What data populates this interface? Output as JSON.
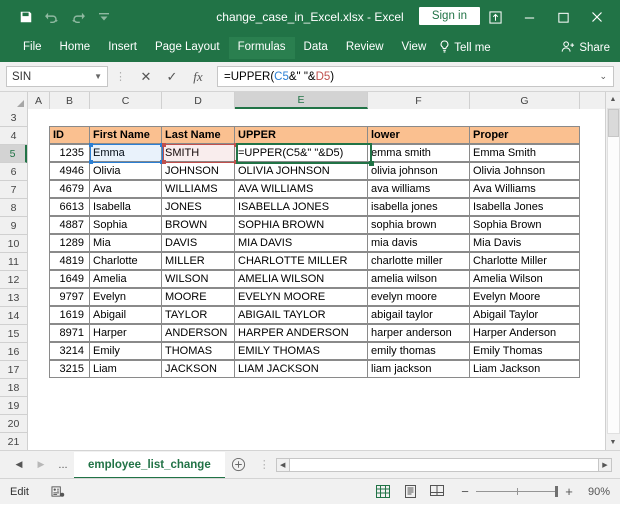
{
  "titlebar": {
    "filename": "change_case_in_Excel.xlsx  -  Excel",
    "signin_label": "Sign in",
    "qat": [
      {
        "name": "save-icon",
        "label": "Save"
      },
      {
        "name": "undo-icon",
        "label": "Undo"
      },
      {
        "name": "redo-icon",
        "label": "Redo"
      },
      {
        "name": "customize-quick-access-toolbar-icon",
        "label": "Customize Quick Access Toolbar"
      }
    ],
    "window_controls": [
      {
        "name": "ribbon-display-options-icon",
        "label": "Ribbon Display Options"
      },
      {
        "name": "minimize-icon",
        "label": "Minimize"
      },
      {
        "name": "maximize-icon",
        "label": "Maximize"
      },
      {
        "name": "close-icon",
        "label": "Close"
      }
    ]
  },
  "ribbon": {
    "tabs": [
      {
        "label": "File",
        "active": false
      },
      {
        "label": "Home",
        "active": false
      },
      {
        "label": "Insert",
        "active": false
      },
      {
        "label": "Page Layout",
        "active": false
      },
      {
        "label": "Formulas",
        "active": true
      },
      {
        "label": "Data",
        "active": false
      },
      {
        "label": "Review",
        "active": false
      },
      {
        "label": "View",
        "active": false
      }
    ],
    "tellme_label": "Tell me",
    "share_label": "Share"
  },
  "formula_bar": {
    "name_box_value": "SIN",
    "cancel_label": "✕",
    "enter_label": "✓",
    "insert_function_label": "fx",
    "formula_parts": [
      {
        "text": "=UPPER(",
        "color": "black"
      },
      {
        "text": "C5",
        "color": "blue"
      },
      {
        "text": "&\" \"&",
        "color": "black"
      },
      {
        "text": "D5",
        "color": "red"
      },
      {
        "text": ")",
        "color": "black"
      }
    ],
    "formula_full": "=UPPER(C5&\" \"&D5)"
  },
  "grid": {
    "columns": [
      "A",
      "B",
      "C",
      "D",
      "E",
      "F",
      "G"
    ],
    "selected_column": "E",
    "selected_row": "5",
    "rows": [
      "3",
      "4",
      "5",
      "6",
      "7",
      "8",
      "9",
      "10",
      "11",
      "12",
      "13",
      "14",
      "15",
      "16",
      "17",
      "18",
      "19",
      "20",
      "21"
    ],
    "header_row_index": "4",
    "headers": {
      "b": "ID",
      "c": "First Name",
      "d": "Last Name",
      "e": "UPPER",
      "f": "lower",
      "g": "Proper"
    },
    "data": [
      {
        "row": "5",
        "id": "1235",
        "first": "Emma",
        "last": "SMITH",
        "upper": "=UPPER(C5&\" \"&D5)",
        "lower": "emma smith",
        "proper": "Emma Smith"
      },
      {
        "row": "6",
        "id": "4946",
        "first": "Olivia",
        "last": "JOHNSON",
        "upper": "OLIVIA JOHNSON",
        "lower": "olivia johnson",
        "proper": "Olivia Johnson"
      },
      {
        "row": "7",
        "id": "4679",
        "first": "Ava",
        "last": "WILLIAMS",
        "upper": "AVA WILLIAMS",
        "lower": "ava williams",
        "proper": "Ava Williams"
      },
      {
        "row": "8",
        "id": "6613",
        "first": "Isabella",
        "last": "JONES",
        "upper": "ISABELLA JONES",
        "lower": "isabella jones",
        "proper": "Isabella Jones"
      },
      {
        "row": "9",
        "id": "4887",
        "first": "Sophia",
        "last": "BROWN",
        "upper": "SOPHIA BROWN",
        "lower": "sophia brown",
        "proper": "Sophia Brown"
      },
      {
        "row": "10",
        "id": "1289",
        "first": "Mia",
        "last": "DAVIS",
        "upper": "MIA DAVIS",
        "lower": "mia davis",
        "proper": "Mia Davis"
      },
      {
        "row": "11",
        "id": "4819",
        "first": "Charlotte",
        "last": "MILLER",
        "upper": "CHARLOTTE MILLER",
        "lower": "charlotte miller",
        "proper": "Charlotte Miller"
      },
      {
        "row": "12",
        "id": "1649",
        "first": "Amelia",
        "last": "WILSON",
        "upper": "AMELIA WILSON",
        "lower": "amelia wilson",
        "proper": "Amelia Wilson"
      },
      {
        "row": "13",
        "id": "9797",
        "first": "Evelyn",
        "last": "MOORE",
        "upper": "EVELYN MOORE",
        "lower": "evelyn moore",
        "proper": "Evelyn Moore"
      },
      {
        "row": "14",
        "id": "1619",
        "first": "Abigail",
        "last": "TAYLOR",
        "upper": "ABIGAIL TAYLOR",
        "lower": "abigail taylor",
        "proper": "Abigail Taylor"
      },
      {
        "row": "15",
        "id": "8971",
        "first": "Harper",
        "last": "ANDERSON",
        "upper": "HARPER ANDERSON",
        "lower": "harper anderson",
        "proper": "Harper Anderson"
      },
      {
        "row": "16",
        "id": "3214",
        "first": "Emily",
        "last": "THOMAS",
        "upper": "EMILY THOMAS",
        "lower": "emily thomas",
        "proper": "Emily Thomas"
      },
      {
        "row": "17",
        "id": "3215",
        "first": "Liam",
        "last": "JACKSON",
        "upper": "LIAM JACKSON",
        "lower": "liam jackson",
        "proper": "Liam Jackson"
      }
    ]
  },
  "sheet_bar": {
    "prev_label": "◀",
    "next_label": "▶",
    "ellipsis_label": "...",
    "active_sheet": "employee_list_change",
    "add_sheet_label": "+"
  },
  "status_bar": {
    "mode": "Edit",
    "accessibility_icon": "accessibility-checker-icon",
    "views": [
      {
        "name": "normal-view-icon",
        "active": true
      },
      {
        "name": "page-layout-view-icon",
        "active": false
      },
      {
        "name": "page-break-preview-icon",
        "active": false
      }
    ],
    "zoom_out_label": "−",
    "zoom_in_label": "+",
    "zoom_level": "90%"
  },
  "colors": {
    "excel_green": "#217346",
    "header_fill": "#fac090",
    "ref_blue": "#2b7fd4",
    "ref_red": "#c0504d"
  }
}
